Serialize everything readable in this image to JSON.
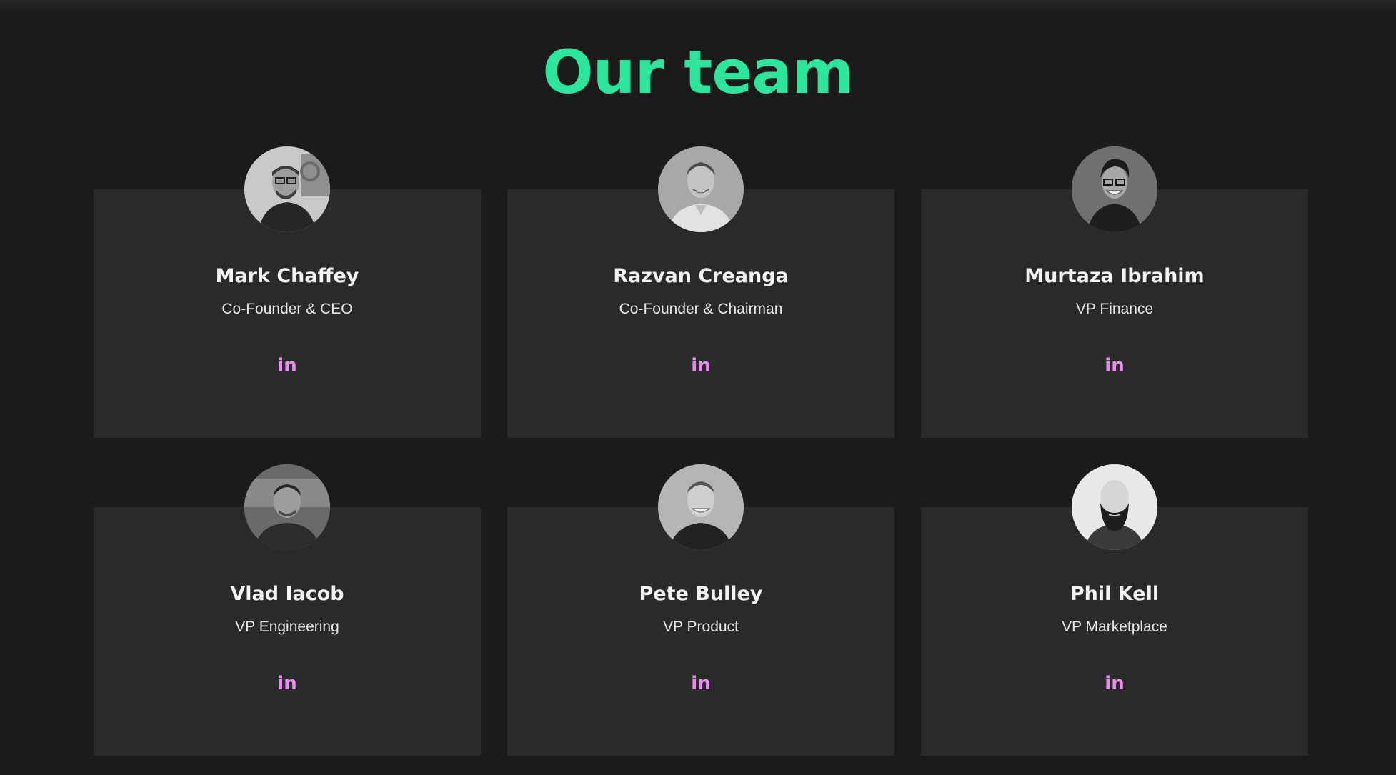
{
  "section": {
    "title": "Our team"
  },
  "linkedin_glyph": "in",
  "colors": {
    "title": "#2ee59d",
    "linkedin": "#e98ef0",
    "card": "#2a2a2a",
    "background": "#1b1b1b"
  },
  "members": [
    {
      "name": "Mark Chaffey",
      "role": "Co-Founder & CEO"
    },
    {
      "name": "Razvan Creanga",
      "role": "Co-Founder & Chairman"
    },
    {
      "name": "Murtaza Ibrahim",
      "role": "VP Finance"
    },
    {
      "name": "Vlad Iacob",
      "role": "VP Engineering"
    },
    {
      "name": "Pete Bulley",
      "role": "VP Product"
    },
    {
      "name": "Phil Kell",
      "role": "VP Marketplace"
    }
  ]
}
